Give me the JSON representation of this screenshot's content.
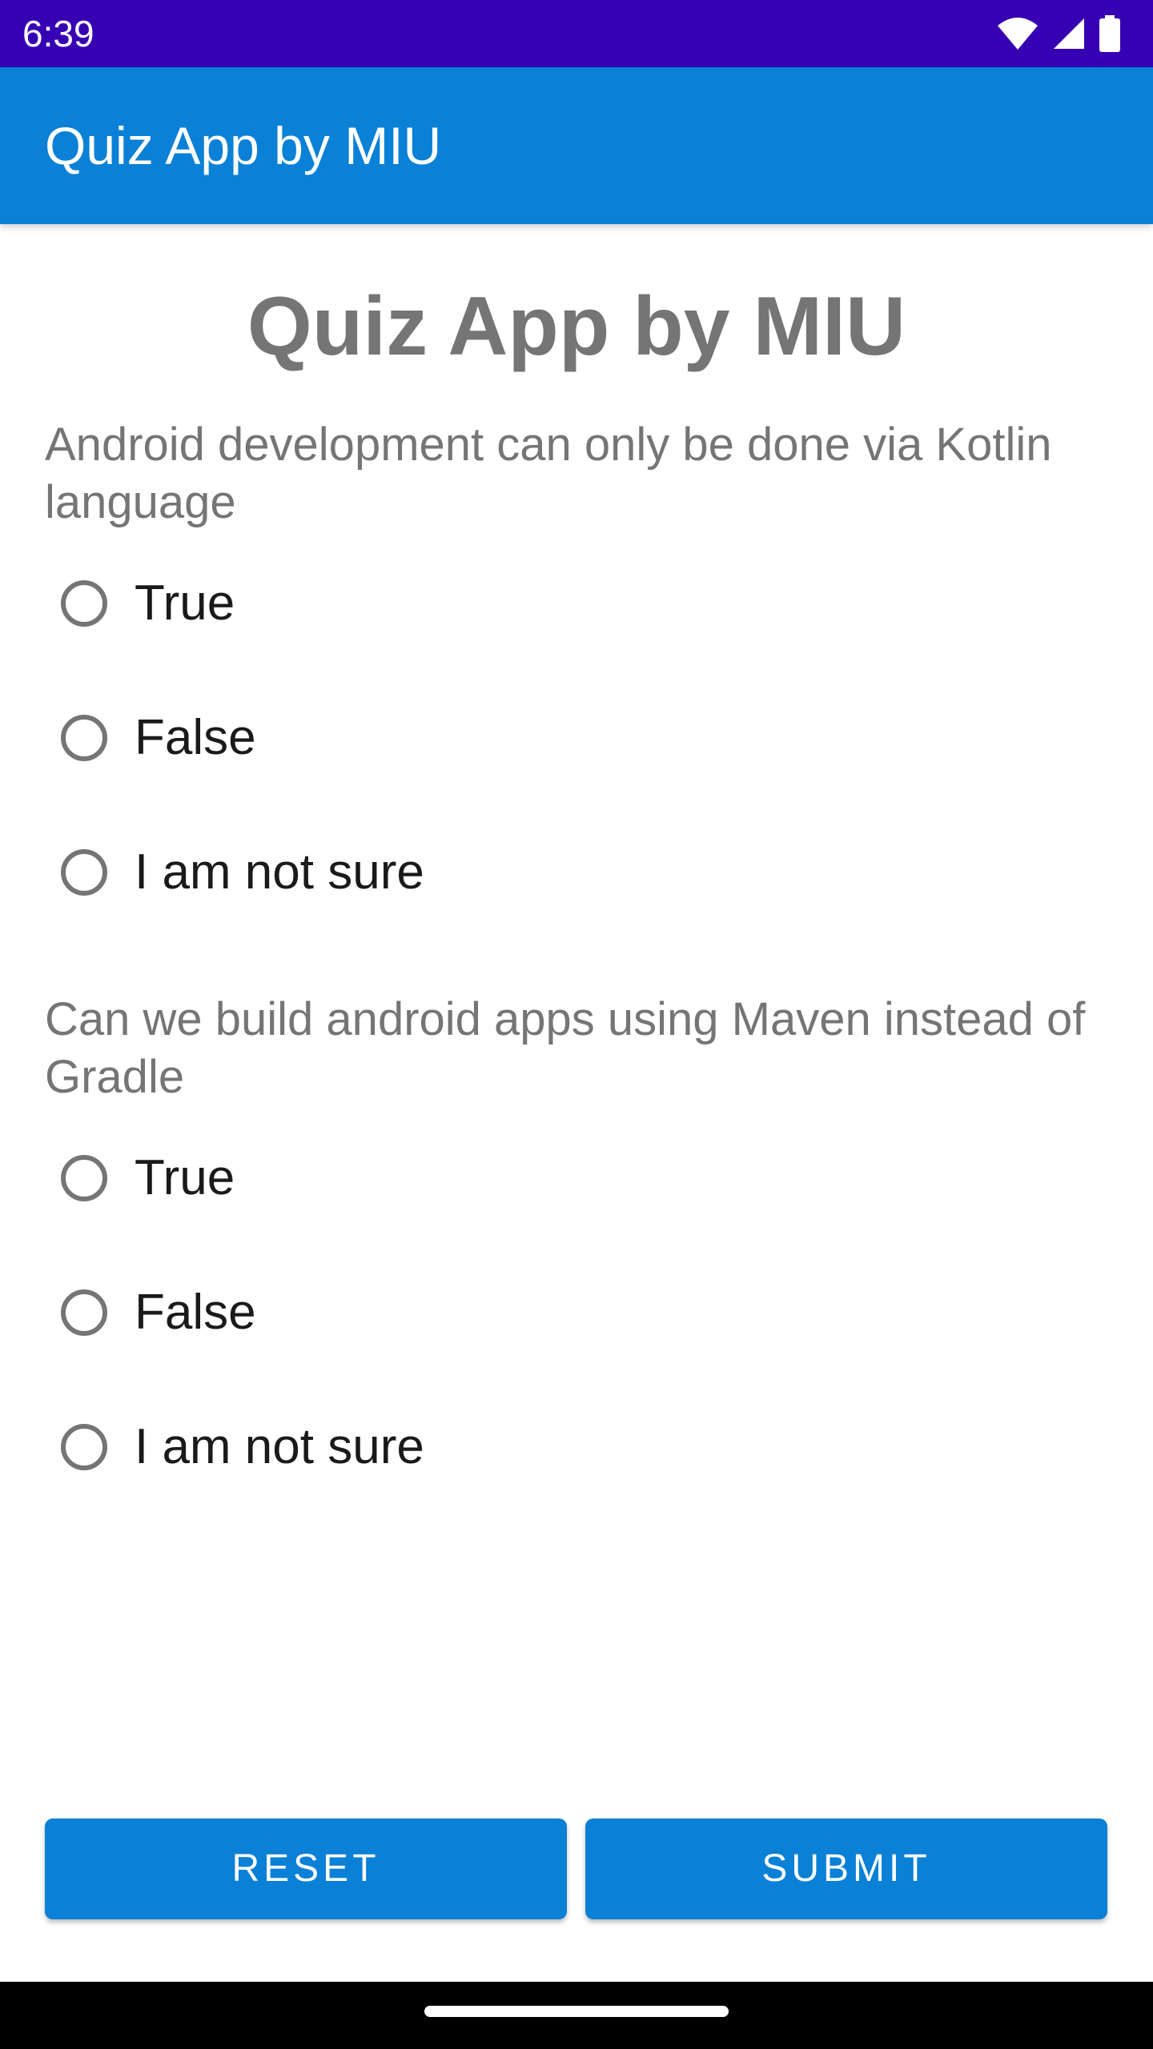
{
  "status_bar": {
    "time": "6:39",
    "icons": [
      "wifi-icon",
      "cell-signal-icon",
      "battery-icon"
    ]
  },
  "app_bar": {
    "title": "Quiz App by MIU"
  },
  "heading": "Quiz App by MIU",
  "questions": [
    {
      "text": "Android development can only be done via Kotlin language",
      "options": [
        {
          "label": "True",
          "selected": false
        },
        {
          "label": "False",
          "selected": false
        },
        {
          "label": "I am not sure",
          "selected": false
        }
      ]
    },
    {
      "text": "Can we build android apps using Maven instead of Gradle",
      "options": [
        {
          "label": "True",
          "selected": false
        },
        {
          "label": "False",
          "selected": false
        },
        {
          "label": "I am not sure",
          "selected": false
        }
      ]
    }
  ],
  "buttons": {
    "reset_label": "RESET",
    "submit_label": "SUBMIT"
  },
  "colors": {
    "status_bar": "#3700b3",
    "app_bar": "#0a80d6",
    "button": "#0a80d6",
    "heading_text": "#757575",
    "option_text": "#1a1a1a"
  }
}
